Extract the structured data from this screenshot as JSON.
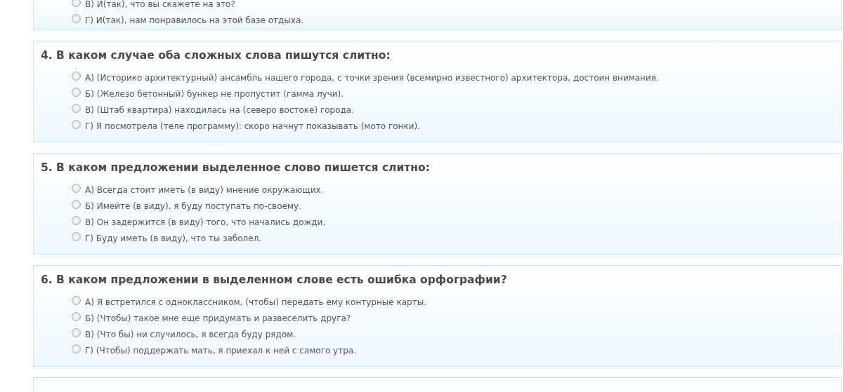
{
  "questions": [
    {
      "options": [
        {
          "label": "В) И(так), что вы скажете на это?",
          "selected": false
        },
        {
          "label": "Г) И(так), нам понравилось на этой базе отдыха.",
          "selected": false
        }
      ]
    },
    {
      "title": "4. В каком случае оба сложных слова пишутся слитно:",
      "options": [
        {
          "label": "А) (Историко архитектурный) ансамбль нашего города, с точки зрения (всемирно известного) архитектора, достоин внимания.",
          "selected": false
        },
        {
          "label": "Б) (Железо бетонный) бункер не пропустит (гамма лучи).",
          "selected": false
        },
        {
          "label": "В) (Штаб квартира) находилась на (северо востоке) города.",
          "selected": false
        },
        {
          "label": "Г) Я посмотрела (теле программу): скоро начнут показывать (мото гонки).",
          "selected": false
        }
      ]
    },
    {
      "title": "5. В каком предложении выделенное слово пишется слитно:",
      "options": [
        {
          "label": "А) Всегда стоит иметь (в виду) мнение окружающих.",
          "selected": false
        },
        {
          "label": "Б) Имейте (в виду), я буду поступать по-своему.",
          "selected": false
        },
        {
          "label": "В) Он задержится (в виду) того, что начались дожди.",
          "selected": false
        },
        {
          "label": "Г) Буду иметь (в виду), что ты заболел.",
          "selected": false
        }
      ]
    },
    {
      "title": "6. В каком предложении в выделенном слове есть ошибка орфографии?",
      "options": [
        {
          "label": "А) Я встретился с одноклассником, (чтобы) передать ему контурные карты.",
          "selected": false
        },
        {
          "label": "Б) (Чтобы) такое мне еще придумать и развеселить друга?",
          "selected": false
        },
        {
          "label": "В) (Что бы) ни случилось, я всегда буду рядом.",
          "selected": false
        },
        {
          "label": "Г) (Чтобы) поддержать мать, я приехал к ней с самого утра.",
          "selected": false
        }
      ]
    }
  ]
}
